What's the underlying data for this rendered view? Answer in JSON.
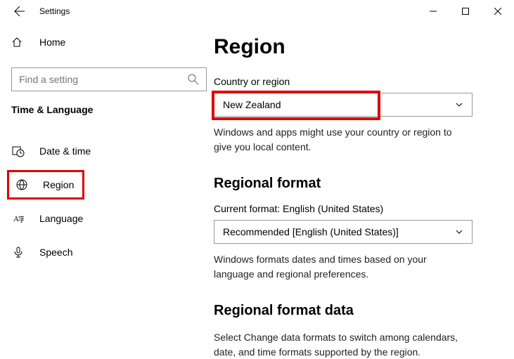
{
  "titlebar": {
    "title": "Settings"
  },
  "sidebar": {
    "home": "Home",
    "search_placeholder": "Find a setting",
    "heading": "Time & Language",
    "items": [
      {
        "label": "Date & time"
      },
      {
        "label": "Region"
      },
      {
        "label": "Language"
      },
      {
        "label": "Speech"
      }
    ]
  },
  "content": {
    "title": "Region",
    "country_label": "Country or region",
    "country_value": "New Zealand",
    "country_desc": "Windows and apps might use your country or region to give you local content.",
    "format_heading": "Regional format",
    "format_current": "Current format: English (United States)",
    "format_value": "Recommended [English (United States)]",
    "format_desc": "Windows formats dates and times based on your language and regional preferences.",
    "data_heading": "Regional format data",
    "data_desc": "Select Change data formats to switch among calendars, date, and time formats supported by the region."
  }
}
